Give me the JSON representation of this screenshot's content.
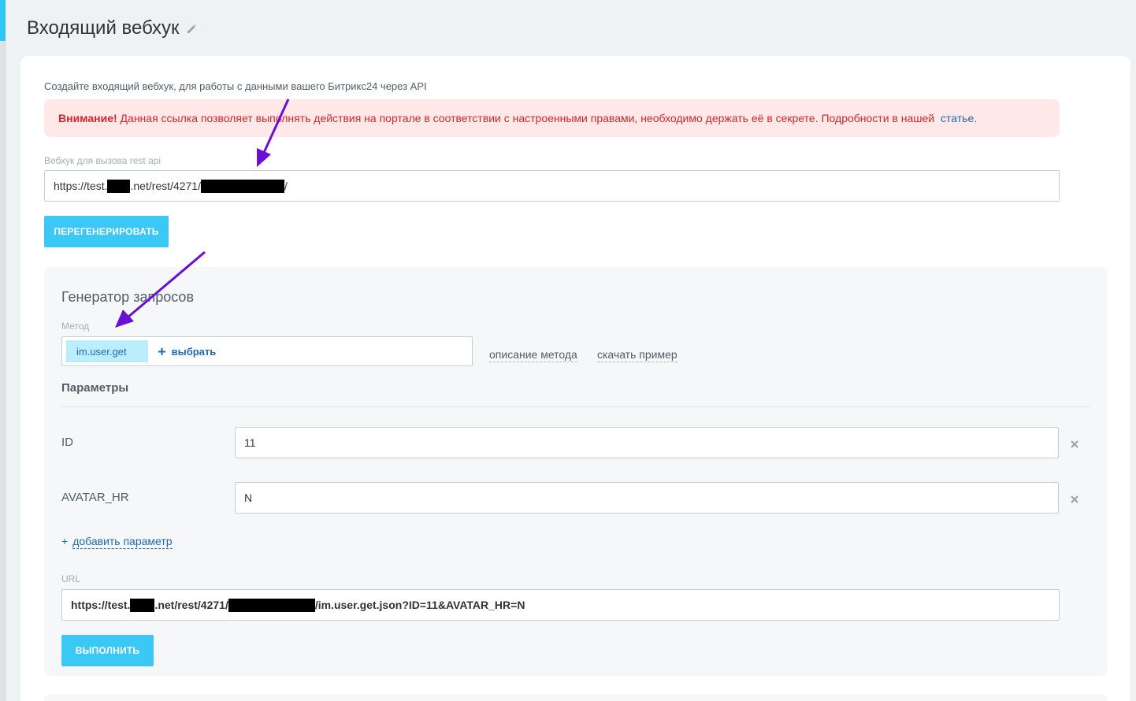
{
  "page": {
    "title": "Входящий вебхук",
    "intro": "Создайте входящий вебхук, для работы с данными вашего Битрикс24 через API"
  },
  "alert": {
    "bold": "Внимание!",
    "text": " Данная ссылка позволяет выполнять действия на портале в соответствии с настроенными правами, необходимо держать её в секрете. Подробности в нашей",
    "link": "статье",
    "tail": "."
  },
  "webhook": {
    "label": "Вебхук для вызова rest api",
    "url_prefix": "https://test.",
    "url_middle": ".net/rest/4271/",
    "url_suffix": "/",
    "regenerate_label": "ПЕРЕГЕНЕРИРОВАТЬ"
  },
  "generator": {
    "title": "Генератор запросов",
    "method_label": "Метод",
    "method_value": "im.user.get",
    "method_select": "выбрать",
    "describe_link": "описание метода",
    "download_link": "скачать пример",
    "params_title": "Параметры",
    "params": [
      {
        "name": "ID",
        "value": "11"
      },
      {
        "name": "AVATAR_HR",
        "value": "N"
      }
    ],
    "add_param_plus": "+",
    "add_param": "добавить параметр",
    "url_label": "URL",
    "url_prefix": "https://test.",
    "url_middle": ".net/rest/4271/",
    "url_suffix": "/im.user.get.json?ID=11&AVATAR_HR=N",
    "execute_label": "ВЫПОЛНИТЬ"
  },
  "colors": {
    "accent": "#3bc8f5",
    "alert_bg": "#ffe8e8",
    "alert_text": "#d0262c",
    "link": "#2067b0",
    "arrow": "#6a0fd4"
  },
  "icons": {
    "title_edit": "pencil-icon",
    "param_remove": "close-icon",
    "annotation": "arrow-icon"
  }
}
